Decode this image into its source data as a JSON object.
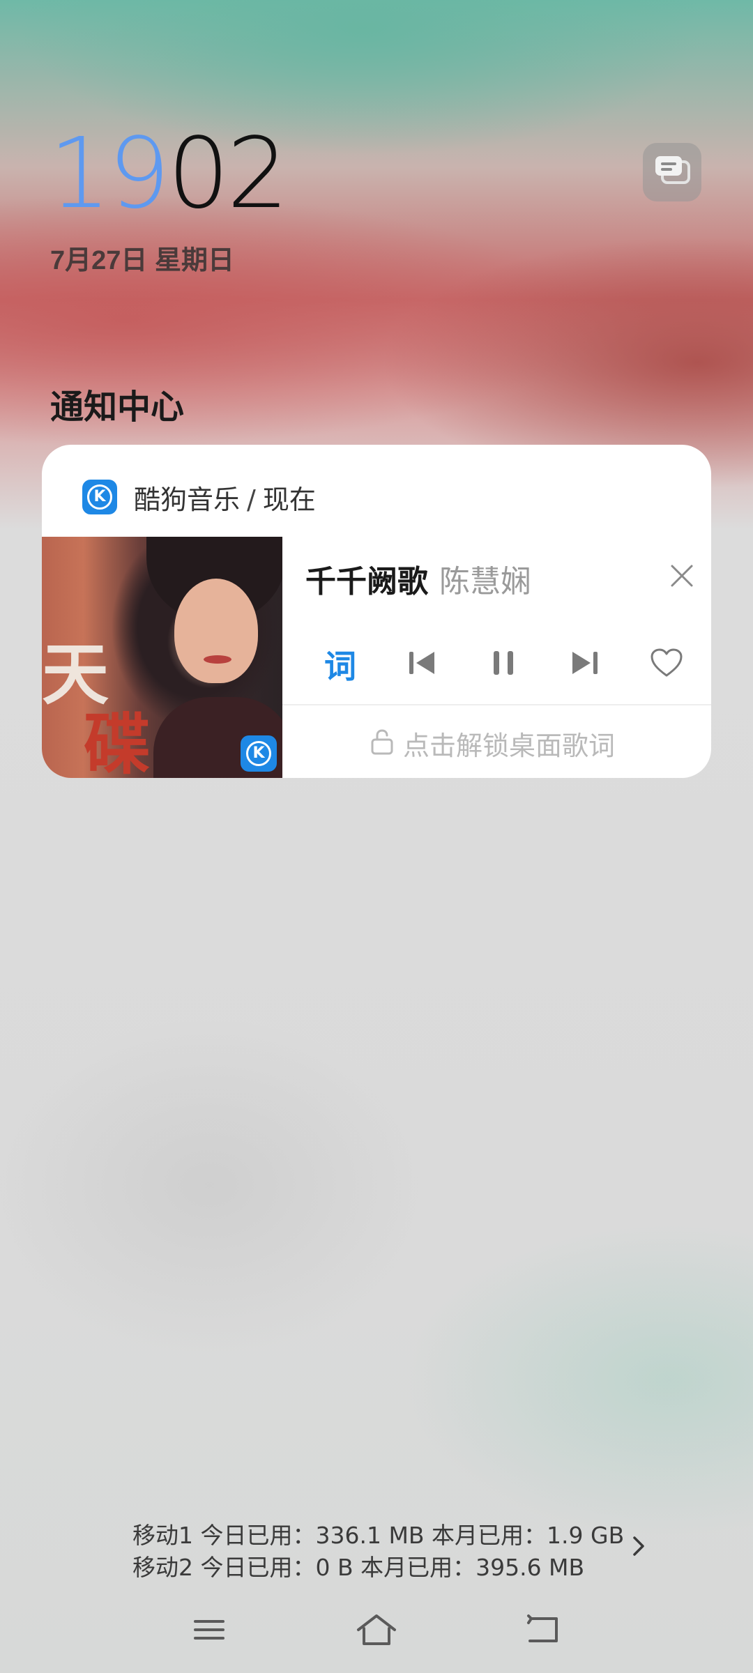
{
  "lockscreen": {
    "hour": "19",
    "minute": "02",
    "date": "7月27日 星期日"
  },
  "notification_center": {
    "title": "通知中心"
  },
  "music_card": {
    "app_name": "酷狗音乐",
    "separator": "/",
    "time": "现在",
    "app_icon_letter": "K",
    "song_title": "千千阙歌",
    "artist": "陈慧娴",
    "album_art_text_1": "天",
    "album_art_text_2": "碟",
    "lyrics_button_label": "词",
    "unlock_lyrics_text": "点击解锁桌面歌词",
    "playing": true
  },
  "data_usage": {
    "line1": "移动1 今日已用：336.1 MB 本月已用：1.9 GB",
    "line2": "移动2 今日已用：0 B 本月已用：395.6 MB"
  },
  "colors": {
    "accent": "#1e88e5",
    "clock_hour": "#5e99f0",
    "control_gray": "#7a7a7a"
  },
  "icons": {
    "messages": "chat-bubbles-icon",
    "close": "close-icon",
    "previous": "skip-previous-icon",
    "pause": "pause-icon",
    "next": "skip-next-icon",
    "favorite": "heart-icon",
    "lock": "unlock-icon",
    "menu": "menu-icon",
    "home": "home-icon",
    "back": "back-icon"
  }
}
